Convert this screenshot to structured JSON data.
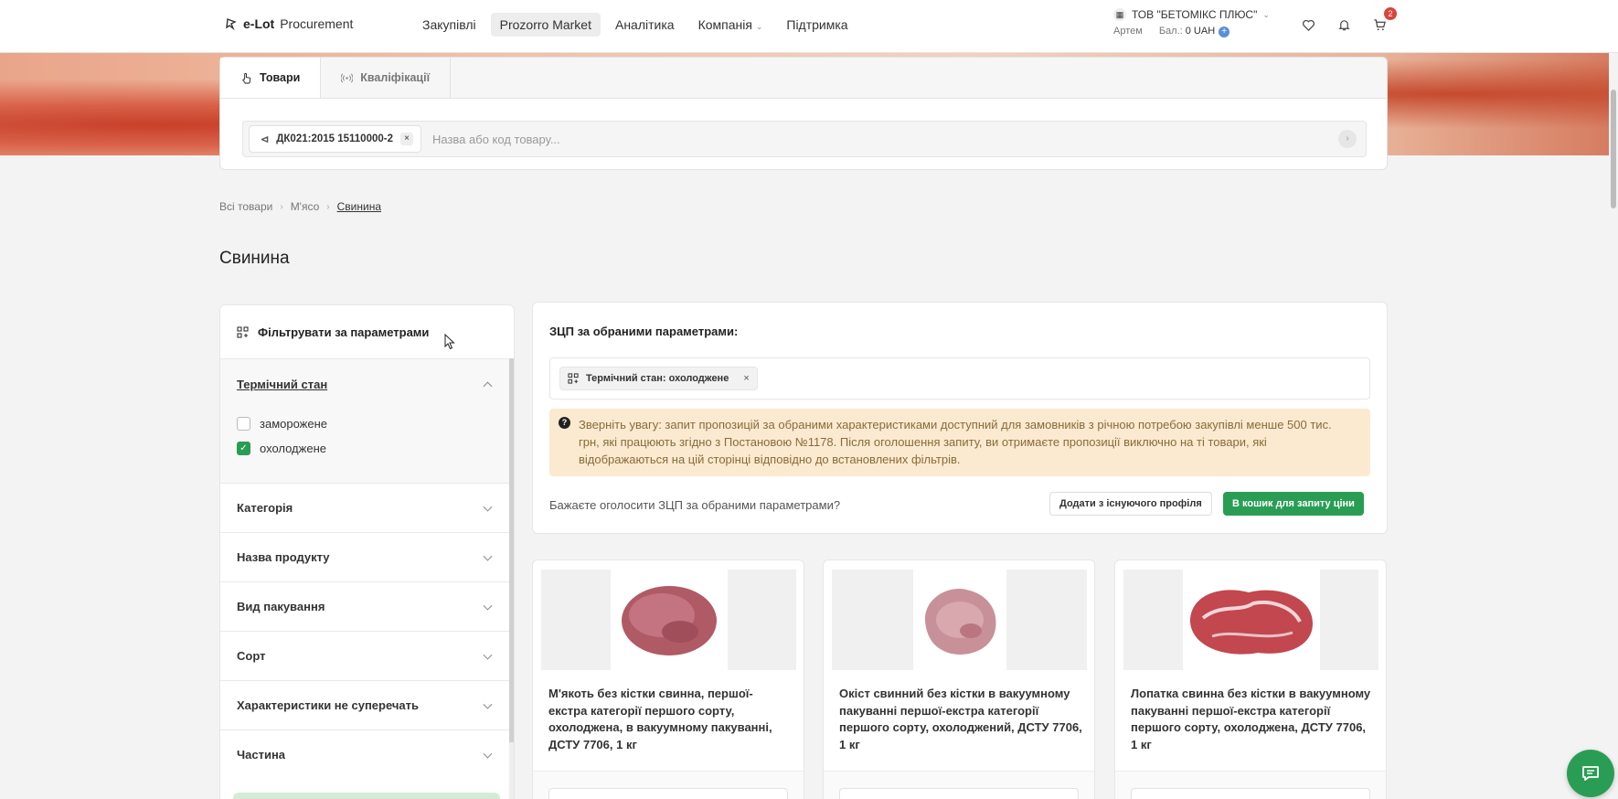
{
  "header": {
    "logo_bold": "e-Lot",
    "logo_text": "Procurement",
    "nav": [
      {
        "label": "Закупівлі",
        "active": false
      },
      {
        "label": "Prozorro Market",
        "active": true
      },
      {
        "label": "Аналітика",
        "active": false
      },
      {
        "label": "Компанія",
        "active": false,
        "has_dropdown": true
      },
      {
        "label": "Підтримка",
        "active": false
      }
    ],
    "company_name": "ТОВ \"БЕТОМІКС ПЛЮС\"",
    "user_name": "Артем",
    "balance_label": "Бал.:",
    "balance_value": "0 UAH",
    "cart_count": "2",
    "icons": [
      "building-icon",
      "heart-icon",
      "bell-icon",
      "cart-icon"
    ]
  },
  "search": {
    "tabs": [
      {
        "label": "Товари",
        "icon": "hand-pointer-icon",
        "active": true
      },
      {
        "label": "Кваліфікації",
        "icon": "broadcast-icon",
        "active": false
      }
    ],
    "chip_label": "ДК021:2015 15110000-2",
    "placeholder": "Назва або код товару..."
  },
  "breadcrumb": [
    "Всі товари",
    "М'ясо",
    "Свинина"
  ],
  "page_title": "Свинина",
  "filter": {
    "title": "Фільтрувати за параметрами",
    "open_section": {
      "title": "Термічний стан",
      "options": [
        {
          "label": "заморожене",
          "checked": false
        },
        {
          "label": "охолоджене",
          "checked": true
        }
      ]
    },
    "sections": [
      "Категорія",
      "Назва продукту",
      "Вид пакування",
      "Сорт",
      "Характеристики не суперечать",
      "Частина"
    ]
  },
  "request": {
    "title": "ЗЦП за обраними параметрами:",
    "active_filter": "Термічний стан: охолоджене",
    "notice": "Зверніть увагу: запит пропозицій за обраними характеристиками доступний для замовників з річною потребою закупівлі менше 500 тис. грн, які працюють згідно з Постановою №1178. Після оголошення запиту, ви отримаєте пропозиції виключно на ті товари, які відображаються на цій сторінці відповідно до встановлених фільтрів.",
    "question": "Бажаєте оголосити ЗЦП за обраними параметрами?",
    "btn_add_profile": "Додати з існуючого профіля",
    "btn_cart": "В кошик для запиту ціни"
  },
  "products": [
    {
      "name": "М'якоть без кістки свинна, першої-екстра категорії першого сорту, охолоджена, в вакуумному пакуванні, ДСТУ 7706, 1 кг"
    },
    {
      "name": "Окіст свинний без кістки в вакуумному пакуванні першої-екстра категорії першого сорту, охолоджений, ДСТУ 7706, 1 кг"
    },
    {
      "name": "Лопатка свинна без кістки в вакуумному пакуванні першої-екстра категорії першого сорту, охолоджена, ДСТУ 7706, 1 кг"
    }
  ],
  "colors": {
    "accent_green": "#2a9d55",
    "badge_red": "#d9453a",
    "notice_bg": "#fbead0"
  }
}
